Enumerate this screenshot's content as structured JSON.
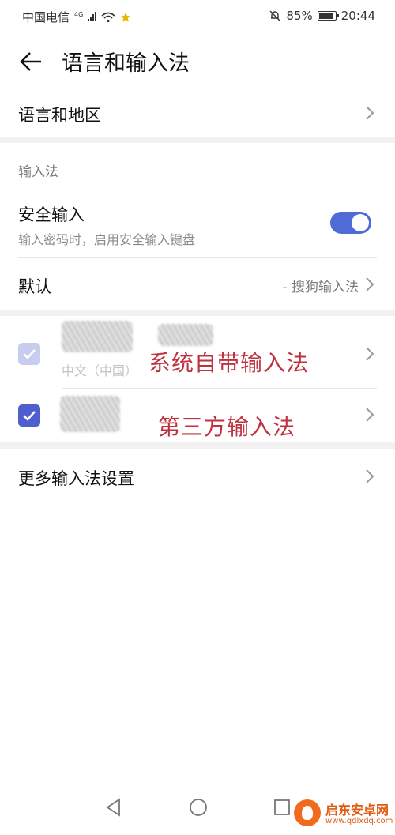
{
  "status_bar": {
    "carrier": "中国电信",
    "network": "4G",
    "battery": "85%",
    "time": "20:44"
  },
  "header": {
    "title": "语言和输入法"
  },
  "language_region": {
    "label": "语言和地区"
  },
  "input_section": {
    "title": "输入法",
    "secure_input": {
      "label": "安全输入",
      "description": "输入密码时，启用安全输入键盘",
      "enabled": true
    },
    "default": {
      "label": "默认",
      "value": "- 搜狗输入法"
    }
  },
  "keyboards": [
    {
      "subtitle": "中文（中国）",
      "checked": true,
      "disabled": true,
      "annotation": "系统自带输入法"
    },
    {
      "checked": true,
      "disabled": false,
      "annotation": "第三方输入法"
    }
  ],
  "more": {
    "label": "更多输入法设置"
  },
  "watermark": {
    "name": "启东安卓网",
    "url": "www.qdlxdq.com"
  },
  "colors": {
    "accent": "#4f6bd6",
    "annotation": "#c0313f",
    "watermark": "#e15a12"
  }
}
